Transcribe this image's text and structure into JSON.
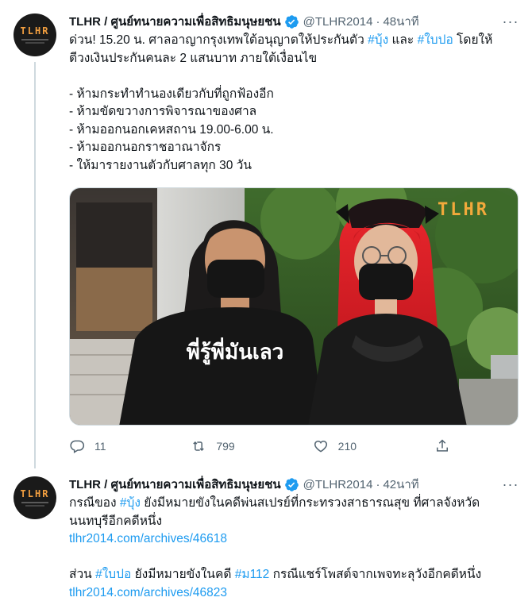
{
  "tweets": [
    {
      "avatar_text": "TLHR",
      "display_name": "TLHR / ศูนย์ทนายความเพื่อสิทธิมนุษยชน",
      "handle": "@TLHR2014",
      "time": "48นาที",
      "body_lines": [
        {
          "parts": [
            {
              "t": "ด่วน! 15.20 น. ศาลอาญากรุงเทพใต้อนุญาตให้ประกันตัว "
            },
            {
              "t": "#บุ้ง",
              "tag": true
            },
            {
              "t": " และ "
            },
            {
              "t": "#ใบปอ",
              "tag": true
            },
            {
              "t": " โดยให้"
            }
          ]
        },
        {
          "parts": [
            {
              "t": "ตีวงเงินประกันคนละ 2 แสนบาท ภายใต้เงื่อนไข"
            }
          ]
        },
        {
          "blank": true
        },
        {
          "parts": [
            {
              "t": "- ห้ามกระทำทำนองเดียวกับที่ถูกฟ้องอีก"
            }
          ]
        },
        {
          "parts": [
            {
              "t": "- ห้ามขัดขวางการพิจารณาของศาล"
            }
          ]
        },
        {
          "parts": [
            {
              "t": "- ห้ามออกนอกเคหสถาน 19.00-6.00 น."
            }
          ]
        },
        {
          "parts": [
            {
              "t": "- ห้ามออกนอกราชอาณาจักร"
            }
          ]
        },
        {
          "parts": [
            {
              "t": "- ให้มารายงานตัวกับศาลทุก 30 วัน"
            }
          ]
        }
      ],
      "media": {
        "watermark": "TLHR",
        "shirt_text": "พี่รู้พี่มันเลว"
      },
      "actions": {
        "reply_count": "11",
        "retweet_count": "799",
        "like_count": "210"
      }
    },
    {
      "avatar_text": "TLHR",
      "display_name": "TLHR / ศูนย์ทนายความเพื่อสิทธิมนุษยชน",
      "handle": "@TLHR2014",
      "time": "42นาที",
      "body_lines": [
        {
          "parts": [
            {
              "t": "กรณีของ "
            },
            {
              "t": "#บุ้ง",
              "tag": true
            },
            {
              "t": " ยังมีหมายขังในคดีพ่นสเปรย์ที่กระทรวงสาธารณสุข ที่ศาลจังหวัด"
            }
          ]
        },
        {
          "parts": [
            {
              "t": "นนทบุรีอีกคดีหนึ่ง"
            }
          ]
        },
        {
          "parts": [
            {
              "t": "tlhr2014.com/archives/46618",
              "link": true
            }
          ]
        },
        {
          "blank": true
        },
        {
          "parts": [
            {
              "t": "ส่วน "
            },
            {
              "t": "#ใบปอ",
              "tag": true
            },
            {
              "t": " ยังมีหมายขังในคดี "
            },
            {
              "t": "#ม112",
              "tag": true
            },
            {
              "t": " กรณีแชร์โพสต์จากเพจทะลุวังอีกคดีหนึ่ง"
            }
          ]
        },
        {
          "parts": [
            {
              "t": "tlhr2014.com/archives/46823",
              "link": true
            }
          ]
        }
      ]
    }
  ],
  "colors": {
    "accent": "#1d9bf0",
    "text": "#0f1419",
    "secondary": "#536471",
    "avatar_logo": "#f4a040"
  }
}
